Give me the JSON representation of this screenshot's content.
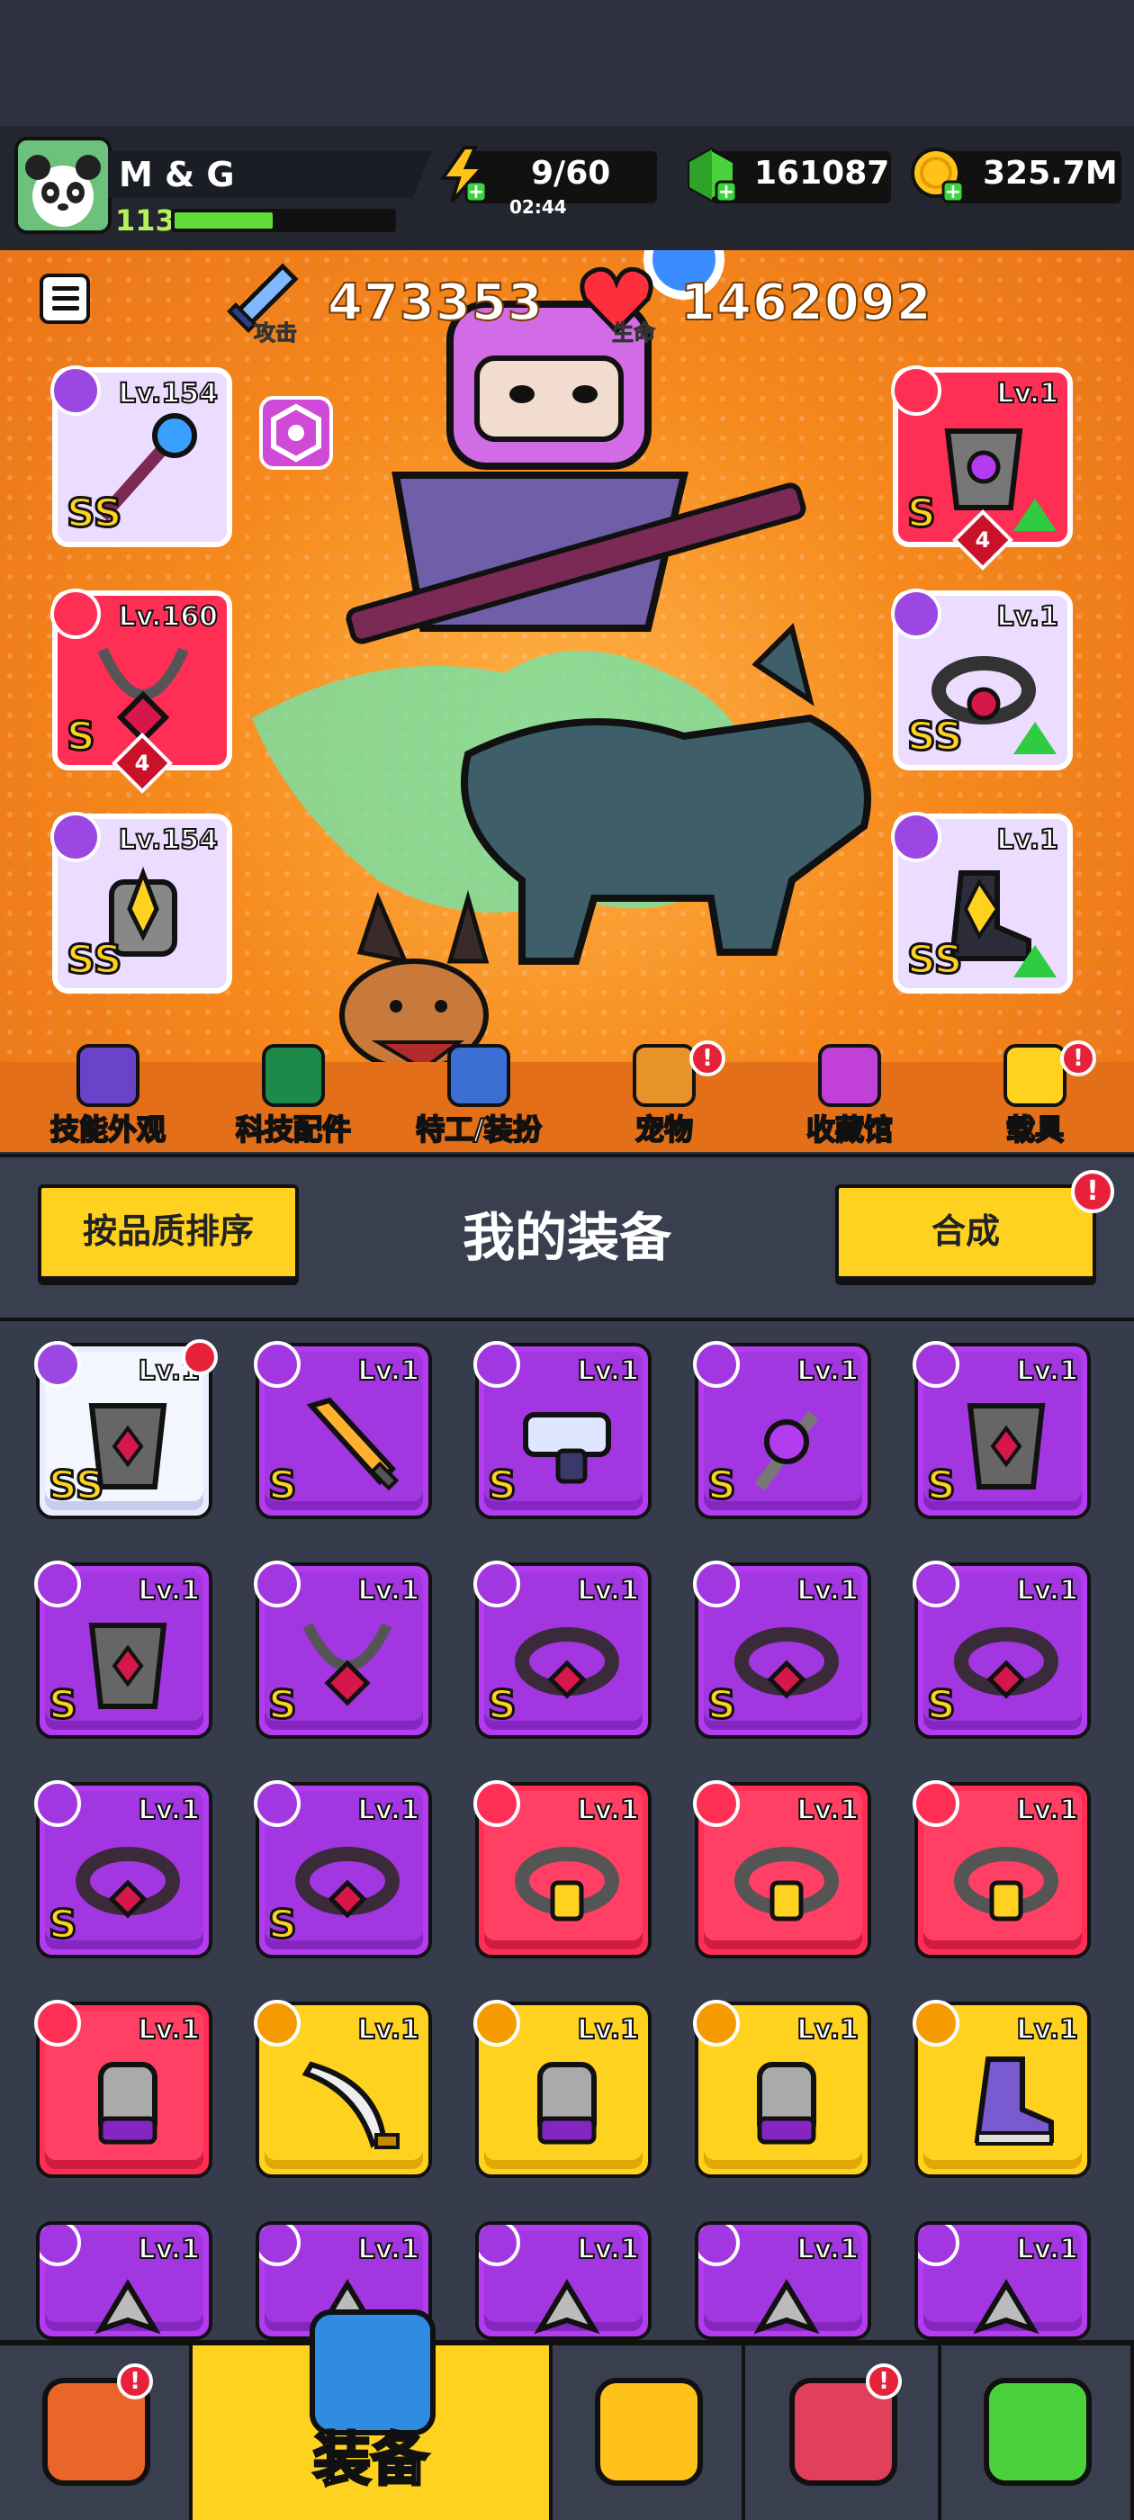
{
  "player": {
    "name": "M & G",
    "level": "113",
    "xp_fraction": 0.45
  },
  "resources": {
    "energy": {
      "value": "9/60",
      "timer": "02:44"
    },
    "gems": {
      "value": "161087"
    },
    "coins": {
      "value": "325.7M"
    }
  },
  "stats": {
    "attack_label": "攻击",
    "attack_value": "473353",
    "hp_label": "生命",
    "hp_value": "1462092"
  },
  "equipped": {
    "left": [
      {
        "level": "Lv.154",
        "grade": "SS",
        "color": "#ecdcff"
      },
      {
        "level": "Lv.160",
        "grade": "S",
        "color": "#ff2e55",
        "stars": "4"
      },
      {
        "level": "Lv.154",
        "grade": "SS",
        "color": "#ecdcff"
      }
    ],
    "right": [
      {
        "level": "Lv.1",
        "grade": "S",
        "color": "#ff2e55",
        "stars": "4"
      },
      {
        "level": "Lv.1",
        "grade": "SS",
        "color": "#ecdcff"
      },
      {
        "level": "Lv.1",
        "grade": "SS",
        "color": "#ecdcff"
      }
    ]
  },
  "quick_menu": [
    {
      "label": "技能外观",
      "icon": "hat-icon"
    },
    {
      "label": "科技配件",
      "icon": "chip-icon"
    },
    {
      "label": "特工/装扮",
      "icon": "agent-icon"
    },
    {
      "label": "宠物",
      "icon": "pet-icon",
      "badge": "!"
    },
    {
      "label": "收藏馆",
      "icon": "chest-icon"
    },
    {
      "label": "载具",
      "icon": "vehicle-icon",
      "badge": "!"
    }
  ],
  "section": {
    "sort_label": "按品质排序",
    "title": "我的装备",
    "merge_label": "合成",
    "merge_badge": "!"
  },
  "grid": [
    [
      {
        "level": "Lv.1",
        "grade": "SS",
        "rarity": "white",
        "new": true,
        "slot": "armor-icon",
        "item": "armor"
      },
      {
        "level": "Lv.1",
        "grade": "S",
        "rarity": "purple",
        "slot": "weapon-icon",
        "item": "sword"
      },
      {
        "level": "Lv.1",
        "grade": "S",
        "rarity": "purple",
        "slot": "weapon-icon",
        "item": "gun"
      },
      {
        "level": "Lv.1",
        "grade": "S",
        "rarity": "purple",
        "slot": "weapon-icon",
        "item": "staff"
      },
      {
        "level": "Lv.1",
        "grade": "S",
        "rarity": "purple",
        "slot": "armor-icon",
        "item": "armor"
      }
    ],
    [
      {
        "level": "Lv.1",
        "grade": "S",
        "rarity": "purple",
        "slot": "armor-icon",
        "item": "armor"
      },
      {
        "level": "Lv.1",
        "grade": "S",
        "rarity": "purple",
        "slot": "necklace-icon",
        "item": "necklace"
      },
      {
        "level": "Lv.1",
        "grade": "S",
        "rarity": "purple",
        "slot": "belt-icon",
        "item": "belt"
      },
      {
        "level": "Lv.1",
        "grade": "S",
        "rarity": "purple",
        "slot": "belt-icon",
        "item": "belt"
      },
      {
        "level": "Lv.1",
        "grade": "S",
        "rarity": "purple",
        "slot": "belt-icon",
        "item": "belt"
      }
    ],
    [
      {
        "level": "Lv.1",
        "grade": "S",
        "rarity": "purple",
        "slot": "belt-icon",
        "item": "belt"
      },
      {
        "level": "Lv.1",
        "grade": "S",
        "rarity": "purple",
        "slot": "belt-icon",
        "item": "belt"
      },
      {
        "level": "Lv.1",
        "grade": "",
        "rarity": "red",
        "slot": "belt-icon",
        "item": "belt2"
      },
      {
        "level": "Lv.1",
        "grade": "",
        "rarity": "red",
        "slot": "belt-icon",
        "item": "belt2"
      },
      {
        "level": "Lv.1",
        "grade": "",
        "rarity": "red",
        "slot": "belt-icon",
        "item": "belt2"
      }
    ],
    [
      {
        "level": "Lv.1",
        "grade": "",
        "rarity": "red",
        "slot": "glove-icon",
        "item": "glove"
      },
      {
        "level": "Lv.1",
        "grade": "",
        "rarity": "yellow",
        "slot": "weapon-icon",
        "item": "sword2"
      },
      {
        "level": "Lv.1",
        "grade": "",
        "rarity": "yellow",
        "slot": "glove-icon",
        "item": "glove"
      },
      {
        "level": "Lv.1",
        "grade": "",
        "rarity": "yellow",
        "slot": "glove-icon",
        "item": "glove"
      },
      {
        "level": "Lv.1",
        "grade": "",
        "rarity": "yellow",
        "slot": "boot-icon",
        "item": "boot"
      }
    ],
    [
      {
        "level": "Lv.1",
        "grade": "",
        "rarity": "purple",
        "slot": "weapon-icon",
        "item": "dart"
      },
      {
        "level": "Lv.1",
        "grade": "",
        "rarity": "purple",
        "slot": "weapon-icon",
        "item": "dart"
      },
      {
        "level": "Lv.1",
        "grade": "",
        "rarity": "purple",
        "slot": "weapon-icon",
        "item": "dart"
      },
      {
        "level": "Lv.1",
        "grade": "",
        "rarity": "purple",
        "slot": "weapon-icon",
        "item": "dart"
      },
      {
        "level": "Lv.1",
        "grade": "",
        "rarity": "purple",
        "slot": "weapon-icon",
        "item": "dart"
      }
    ]
  ],
  "bottom_nav": [
    {
      "label": "",
      "icon": "shop-icon",
      "badge": "!"
    },
    {
      "label": "装备",
      "icon": "equipment-icon",
      "active": true
    },
    {
      "label": "",
      "icon": "battle-icon"
    },
    {
      "label": "",
      "icon": "egg-icon",
      "badge": "!"
    },
    {
      "label": "",
      "icon": "dna-icon"
    }
  ]
}
